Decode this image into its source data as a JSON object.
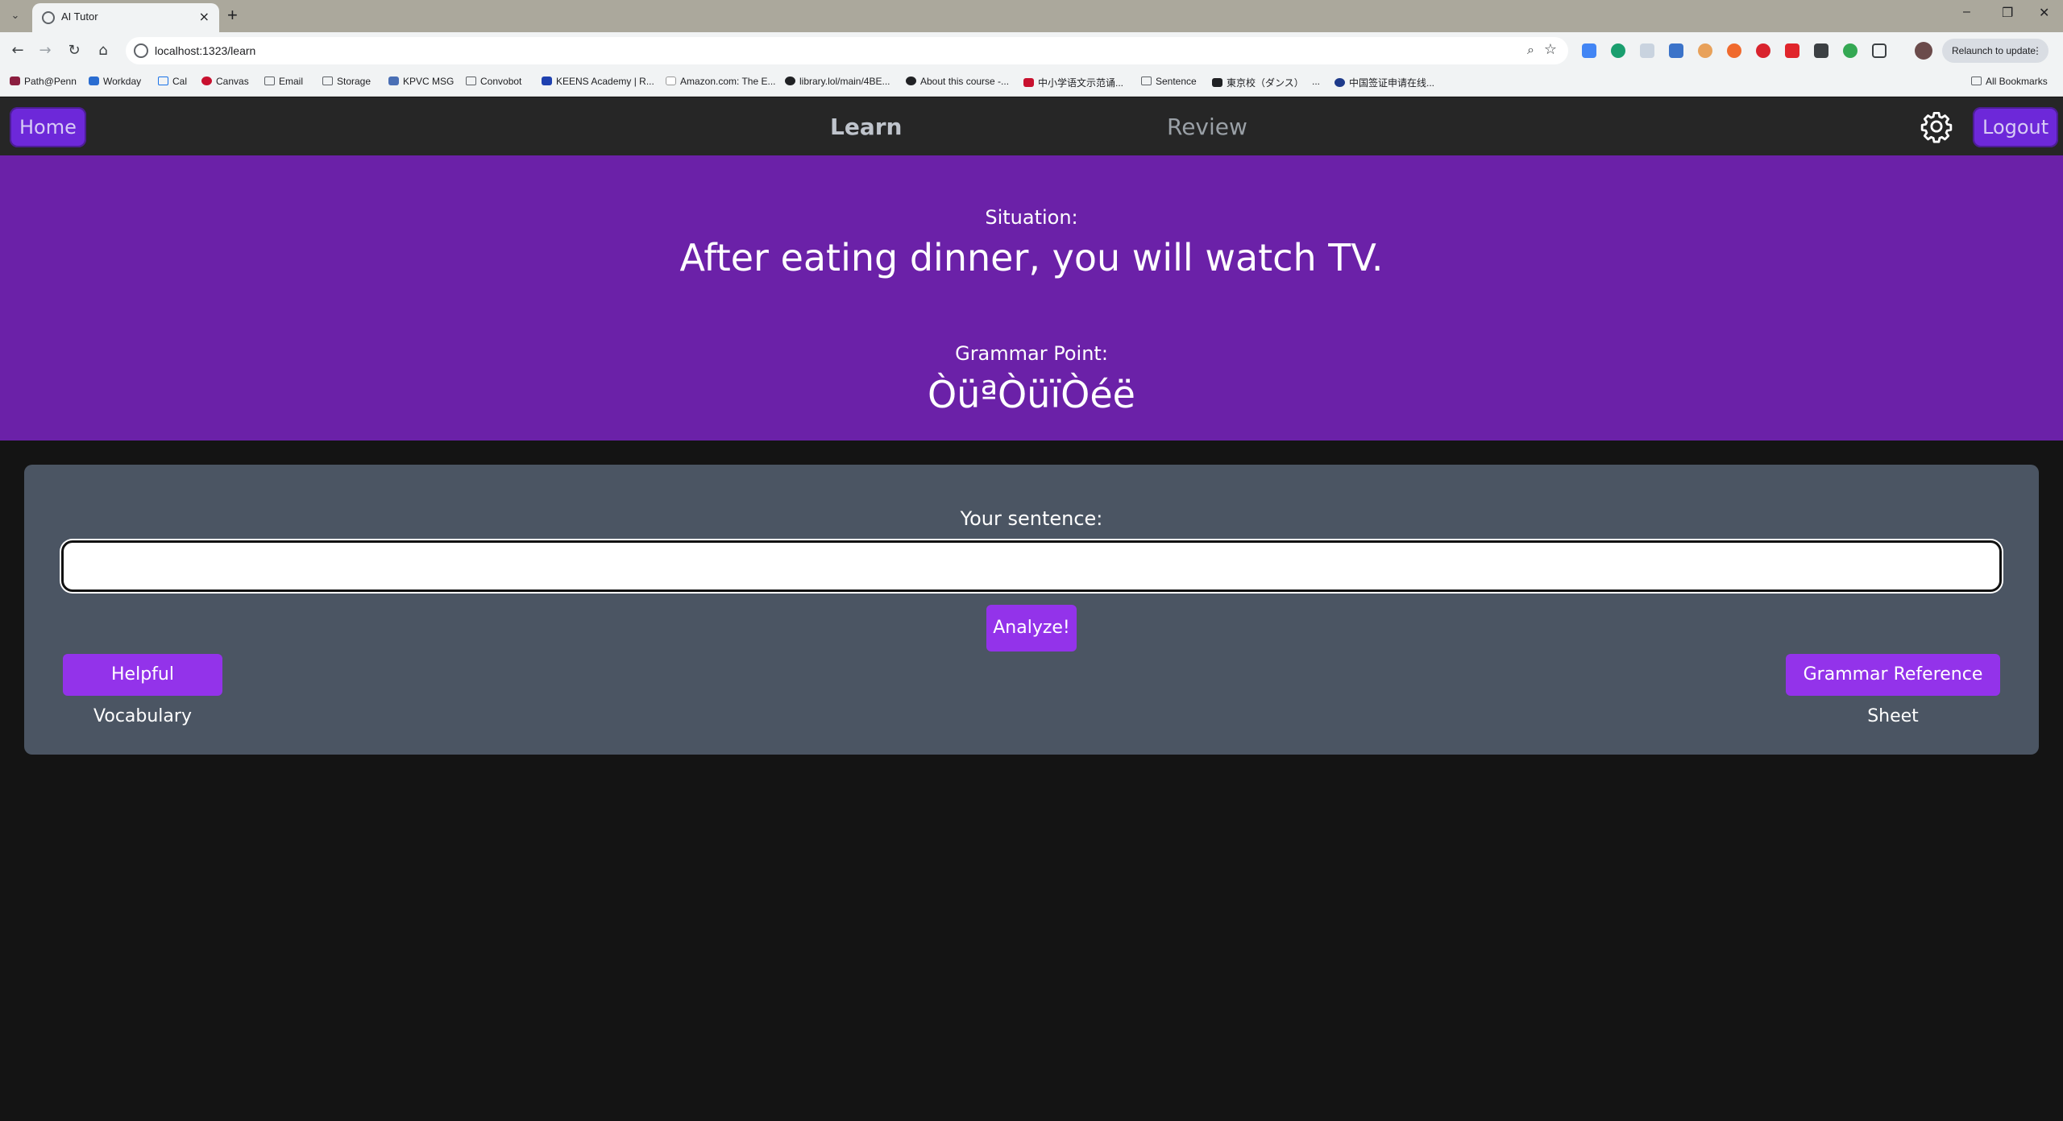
{
  "browser": {
    "tab_title": "AI Tutor",
    "url": "localhost:1323/learn",
    "relaunch_label": "Relaunch to update",
    "bookmarks": [
      {
        "label": "Path@Penn"
      },
      {
        "label": "Workday"
      },
      {
        "label": "Cal"
      },
      {
        "label": "Canvas"
      },
      {
        "label": "Email"
      },
      {
        "label": "Storage"
      },
      {
        "label": "KPVC MSG"
      },
      {
        "label": "Convobot"
      },
      {
        "label": "KEENS Academy | R..."
      },
      {
        "label": "Amazon.com: The E..."
      },
      {
        "label": "library.lol/main/4BE..."
      },
      {
        "label": "About this course -..."
      },
      {
        "label": "中小学语文示范诵..."
      },
      {
        "label": "Sentence"
      },
      {
        "label": "東京校（ダンス）"
      },
      {
        "label": "..."
      },
      {
        "label": "中国签证申请在线..."
      }
    ],
    "all_bookmarks_label": "All Bookmarks"
  },
  "nav": {
    "home_label": "Home",
    "learn_label": "Learn",
    "review_label": "Review",
    "logout_label": "Logout"
  },
  "hero": {
    "situation_label": "Situation:",
    "situation_text": "After eating dinner, you will watch TV.",
    "grammar_label": "Grammar Point:",
    "grammar_text": "ÒüªÒüïÒéë"
  },
  "card": {
    "sentence_label": "Your sentence:",
    "sentence_value": "",
    "analyze_label": "Analyze!",
    "vocab_label": "Helpful Vocabulary",
    "grammar_ref_label": "Grammar Reference Sheet"
  },
  "colors": {
    "hero_bg": "#6b21a8",
    "button_bg": "#9333ea",
    "card_bg": "#4b5563",
    "page_bg": "#141414"
  }
}
